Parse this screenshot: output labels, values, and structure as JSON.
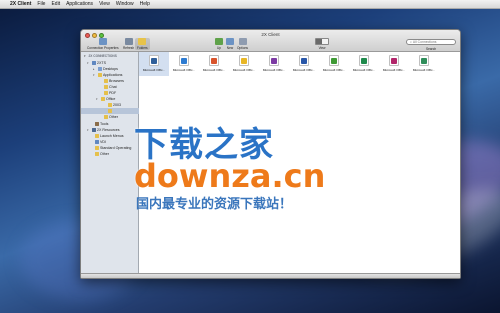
{
  "menubar": {
    "app_name": "2X Client",
    "items": [
      "File",
      "Edit",
      "Applications",
      "View",
      "Window",
      "Help"
    ]
  },
  "window": {
    "title": "2X Client",
    "toolbar": {
      "connection_properties": "Connection Properties",
      "refresh": "Refresh",
      "folders": "Folders",
      "up": "Up",
      "new": "New",
      "options": "Options",
      "view": "View",
      "search_label": "Search",
      "search_placeholder": "All Connections"
    },
    "sidebar": {
      "header": "2X CONNECTIONS",
      "items": [
        {
          "label": "2XTS"
        },
        {
          "label": "Desktops"
        },
        {
          "label": "Applications"
        },
        {
          "label": "Browsers"
        },
        {
          "label": "Chat"
        },
        {
          "label": "PDF"
        },
        {
          "label": "Office"
        },
        {
          "label": "2003"
        },
        {
          "label": ""
        },
        {
          "label": "Other"
        },
        {
          "label": "Tools"
        },
        {
          "label": "2X Resources"
        },
        {
          "label": "Launch Menus"
        },
        {
          "label": "VDI"
        },
        {
          "label": "Standard Operating"
        },
        {
          "label": "Other"
        }
      ]
    },
    "grid_items": [
      {
        "label": "Microsoft Offic...",
        "color": "#2f5f9a"
      },
      {
        "label": "Microsoft Offic...",
        "color": "#2d7bd1"
      },
      {
        "label": "Microsoft Offic...",
        "color": "#d8532b"
      },
      {
        "label": "Microsoft Offic...",
        "color": "#e8b625"
      },
      {
        "label": "Microsoft Offic...",
        "color": "#7c3aa3"
      },
      {
        "label": "Microsoft Offic...",
        "color": "#2856a8"
      },
      {
        "label": "Microsoft Offic...",
        "color": "#3f9a35"
      },
      {
        "label": "Microsoft Offic...",
        "color": "#1f8a4c"
      },
      {
        "label": "Microsoft Offic...",
        "color": "#b2256a"
      },
      {
        "label": "Microsoft Offic...",
        "color": "#2f8d5a"
      }
    ]
  },
  "watermark": {
    "chinese": "下载之家",
    "domain": "downza.cn",
    "tagline": "国内最专业的资源下载站！"
  }
}
